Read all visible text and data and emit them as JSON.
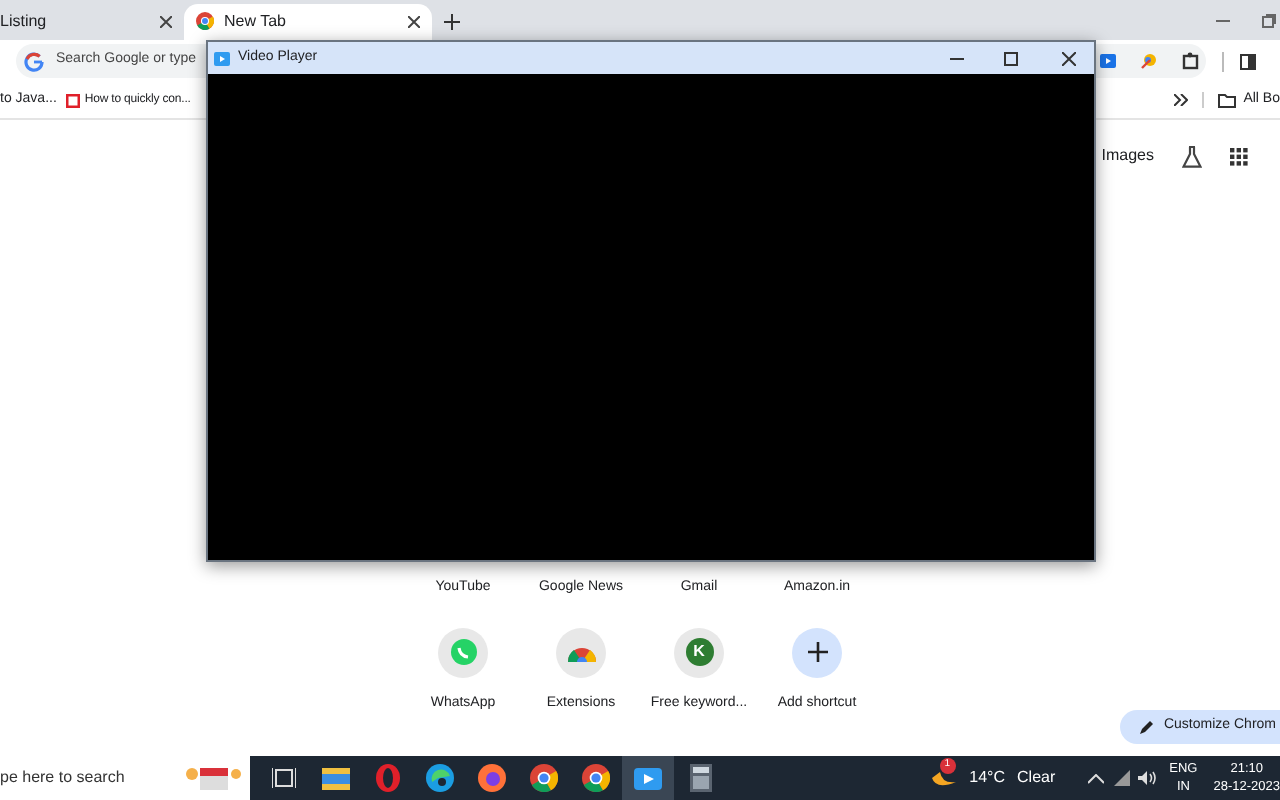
{
  "browser": {
    "tabs": [
      {
        "title": "Listing",
        "selected": false
      },
      {
        "title": "New Tab",
        "selected": true
      }
    ],
    "address_placeholder": "Search Google or type",
    "bookmarks": [
      {
        "title": "to Java..."
      },
      {
        "title": "How to quickly con..."
      }
    ],
    "all_bookmarks": "All Bo"
  },
  "top_links": [
    "Images"
  ],
  "shortcuts": [
    {
      "label": "YouTube",
      "kind": "hidden"
    },
    {
      "label": "Google News",
      "kind": "hidden"
    },
    {
      "label": "Gmail",
      "kind": "hidden"
    },
    {
      "label": "Amazon.in",
      "kind": "hidden"
    },
    {
      "label": "WhatsApp",
      "kind": "whatsapp"
    },
    {
      "label": "Extensions",
      "kind": "chrome"
    },
    {
      "label": "Free keyword...",
      "kind": "letter",
      "letter": "K"
    },
    {
      "label": "Add shortcut",
      "kind": "add"
    }
  ],
  "customize_button": "Customize Chrom",
  "video_window": {
    "title": "Video Player"
  },
  "taskbar": {
    "search_placeholder": "pe here to search",
    "apps": [
      {
        "kind": "taskview",
        "selected": false
      },
      {
        "kind": "folder",
        "selected": false
      },
      {
        "kind": "opera",
        "selected": false
      },
      {
        "kind": "edge",
        "selected": false
      },
      {
        "kind": "firefox",
        "selected": false
      },
      {
        "kind": "chrome",
        "selected": false
      },
      {
        "kind": "chrome",
        "selected": false
      },
      {
        "kind": "player",
        "selected": true
      },
      {
        "kind": "calculator",
        "selected": false
      }
    ],
    "weather": {
      "badge": "1",
      "temperature": "14°C",
      "condition": "Clear"
    },
    "language": "ENG",
    "region": "IN",
    "time": "21:10",
    "date": "28-12-2023"
  }
}
